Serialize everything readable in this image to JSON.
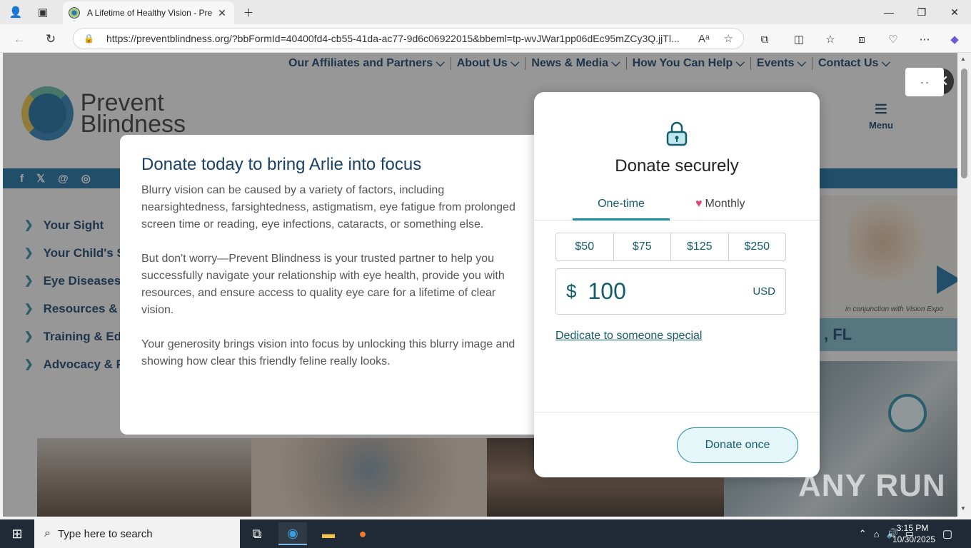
{
  "browser": {
    "tab_title": "A Lifetime of Healthy Vision - Pre",
    "url": "https://preventblindness.org/?bbFormId=40400fd4-cb55-41da-ac77-9d6c06922015&bbeml=tp-wvJWar1pp06dEc95mZCy3Q.jjTl..."
  },
  "site": {
    "top_nav": [
      "Our Affiliates and Partners ⌵",
      "About Us ⌵",
      "News & Media ⌵",
      "How You Can Help ⌵",
      "Events ⌵",
      "Contact Us ⌵"
    ],
    "logo_line1": "Prevent",
    "logo_line2": "Blindness",
    "menu_label": "Menu",
    "left_nav": [
      "Your Sight",
      "Your Child's Si",
      "Eye Diseases &",
      "Resources & S",
      "Training & Edu",
      "Advocacy & Pu"
    ],
    "hero_caption": "in conjunction with Vision Expo",
    "hero_band_text": ", FL"
  },
  "modal": {
    "title": "Donate today to bring Arlie into focus",
    "paragraphs": [
      "Blurry vision can be caused by a variety of factors, including nearsightedness, farsightedness, astigmatism, eye fatigue from prolonged screen time or reading, eye infections, cataracts, or something else.",
      "But don't worry—Prevent Blindness is your trusted partner to help you successfully navigate your relationship with eye health, provide you with resources, and ensure access to quality eye care for a lifetime of clear vision.",
      "Your generosity brings vision into focus by unlocking this blurry image and showing how clear this friendly feline really looks."
    ],
    "form": {
      "title": "Donate securely",
      "tab_onetime": "One-time",
      "tab_monthly": "Monthly",
      "amounts": [
        "$50",
        "$75",
        "$125",
        "$250"
      ],
      "currency_symbol": "$",
      "amount_value": "100",
      "currency_code": "USD",
      "dedicate_link": "Dedicate to someone special",
      "donate_button": "Donate once"
    },
    "lang_button": "- -"
  },
  "watermark": "ANY RUN",
  "taskbar": {
    "search_placeholder": "Type here to search",
    "time": "3:15 PM",
    "date": "10/30/2025"
  },
  "colors": {
    "brand_navy": "#17406a",
    "brand_teal": "#135c6b",
    "accent_teal": "#1a8aa0",
    "heart": "#e0457b"
  }
}
